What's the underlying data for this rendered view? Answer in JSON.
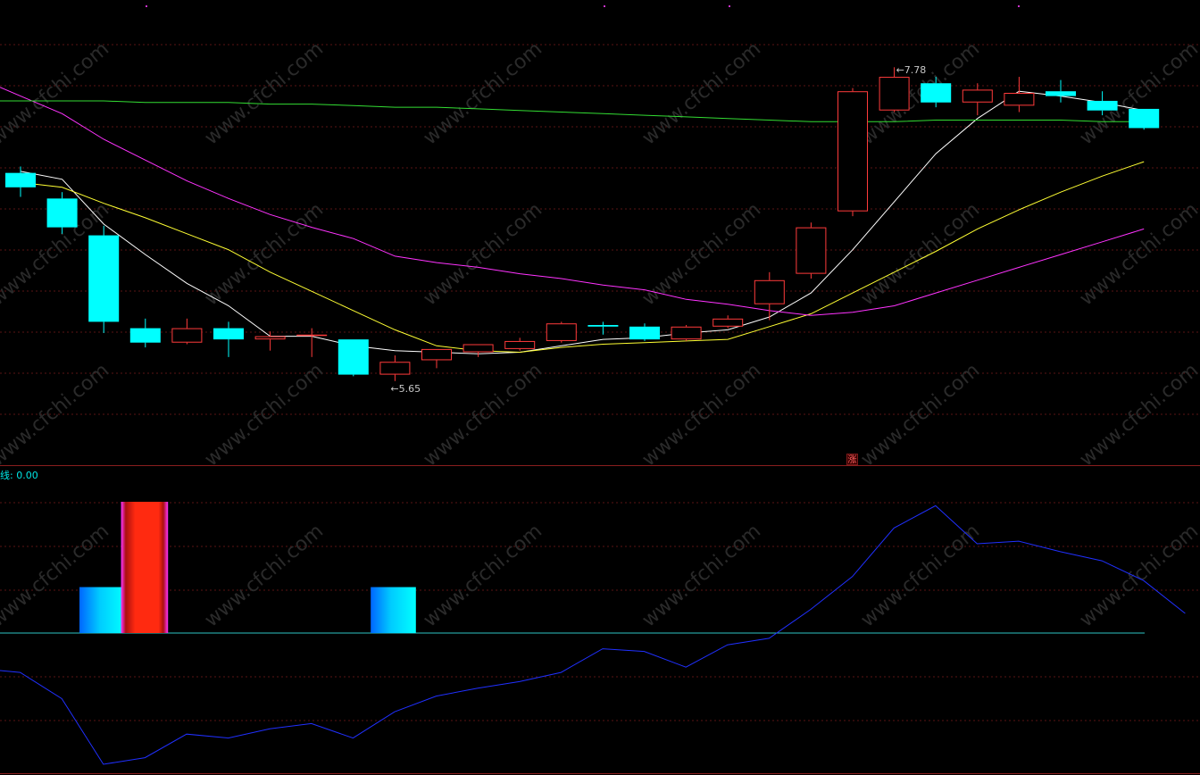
{
  "chart_data": [
    {
      "type": "candlestick",
      "panel": "price",
      "ylim": [
        5.3,
        8.2
      ],
      "grid": true,
      "annotations": [
        {
          "text": "7.78",
          "x_index": 21,
          "value": 7.78
        },
        {
          "text": "5.65",
          "x_index": 9,
          "value": 5.65
        }
      ],
      "badge": "涨",
      "candles": [
        {
          "open": 7.12,
          "high": 7.16,
          "low": 6.97,
          "close": 7.03
        },
        {
          "open": 6.96,
          "high": 7.0,
          "low": 6.74,
          "close": 6.78
        },
        {
          "open": 6.73,
          "high": 6.79,
          "low": 6.12,
          "close": 6.19
        },
        {
          "open": 6.15,
          "high": 6.21,
          "low": 6.03,
          "close": 6.06
        },
        {
          "open": 6.06,
          "high": 6.21,
          "low": 6.05,
          "close": 6.15
        },
        {
          "open": 6.15,
          "high": 6.19,
          "low": 5.97,
          "close": 6.08
        },
        {
          "open": 6.08,
          "high": 6.13,
          "low": 6.01,
          "close": 6.1
        },
        {
          "open": 6.11,
          "high": 6.15,
          "low": 5.97,
          "close": 6.11
        },
        {
          "open": 6.08,
          "high": 6.08,
          "low": 5.85,
          "close": 5.86
        },
        {
          "open": 5.86,
          "high": 5.98,
          "low": 5.82,
          "close": 5.94
        },
        {
          "open": 5.95,
          "high": 6.02,
          "low": 5.9,
          "close": 6.02
        },
        {
          "open": 6.0,
          "high": 6.05,
          "low": 5.97,
          "close": 6.05
        },
        {
          "open": 6.02,
          "high": 6.09,
          "low": 6.01,
          "close": 6.07
        },
        {
          "open": 6.07,
          "high": 6.19,
          "low": 6.06,
          "close": 6.18
        },
        {
          "open": 6.17,
          "high": 6.19,
          "low": 6.11,
          "close": 6.16
        },
        {
          "open": 6.16,
          "high": 6.18,
          "low": 6.07,
          "close": 6.08
        },
        {
          "open": 6.08,
          "high": 6.17,
          "low": 6.07,
          "close": 6.16
        },
        {
          "open": 6.16,
          "high": 6.23,
          "low": 6.15,
          "close": 6.21
        },
        {
          "open": 6.3,
          "high": 6.5,
          "low": 6.2,
          "close": 6.45
        },
        {
          "open": 6.49,
          "high": 6.81,
          "low": 6.46,
          "close": 6.78
        },
        {
          "open": 6.88,
          "high": 7.65,
          "low": 6.85,
          "close": 7.63
        },
        {
          "open": 7.51,
          "high": 7.78,
          "low": 7.5,
          "close": 7.72
        },
        {
          "open": 7.68,
          "high": 7.72,
          "low": 7.53,
          "close": 7.56
        },
        {
          "open": 7.56,
          "high": 7.68,
          "low": 7.48,
          "close": 7.64
        },
        {
          "open": 7.54,
          "high": 7.72,
          "low": 7.5,
          "close": 7.62
        },
        {
          "open": 7.63,
          "high": 7.7,
          "low": 7.56,
          "close": 7.6
        },
        {
          "open": 7.57,
          "high": 7.63,
          "low": 7.48,
          "close": 7.51
        },
        {
          "open": 7.52,
          "high": 7.52,
          "low": 7.39,
          "close": 7.4
        }
      ],
      "series": [
        {
          "color": "#ffffff",
          "values": [
            7.13,
            7.08,
            6.8,
            6.61,
            6.43,
            6.29,
            6.1,
            6.1,
            6.04,
            6.01,
            6.0,
            5.99,
            6.0,
            6.04,
            6.08,
            6.09,
            6.12,
            6.14,
            6.22,
            6.37,
            6.64,
            6.94,
            7.24,
            7.46,
            7.63,
            7.6,
            7.56,
            7.51
          ]
        },
        {
          "color": "#ffff33",
          "values": [
            7.06,
            7.03,
            6.93,
            6.84,
            6.74,
            6.64,
            6.5,
            6.38,
            6.26,
            6.14,
            6.04,
            6.01,
            6.0,
            6.03,
            6.05,
            6.06,
            6.07,
            6.08,
            6.16,
            6.24,
            6.37,
            6.5,
            6.63,
            6.77,
            6.89,
            7.0,
            7.1,
            7.19
          ]
        },
        {
          "color": "#ff33ff",
          "values": [
            7.6,
            7.49,
            7.33,
            7.2,
            7.07,
            6.96,
            6.86,
            6.78,
            6.71,
            6.6,
            6.56,
            6.53,
            6.49,
            6.46,
            6.42,
            6.39,
            6.33,
            6.3,
            6.26,
            6.23,
            6.25,
            6.29,
            6.37,
            6.45,
            6.53,
            6.61,
            6.69,
            6.77
          ]
        },
        {
          "color": "#33dd33",
          "values": [
            7.57,
            7.57,
            7.57,
            7.56,
            7.56,
            7.56,
            7.55,
            7.55,
            7.54,
            7.53,
            7.53,
            7.52,
            7.51,
            7.5,
            7.49,
            7.48,
            7.47,
            7.46,
            7.45,
            7.44,
            7.44,
            7.44,
            7.45,
            7.45,
            7.45,
            7.45,
            7.44,
            7.44
          ]
        }
      ]
    },
    {
      "type": "bar+line",
      "panel": "indicator",
      "label": "线: 0.00",
      "ylim": [
        -100,
        100
      ],
      "zero_line": 0,
      "bars": [
        {
          "start_index": 1,
          "end_index": 2,
          "value": 35,
          "color": "cyan"
        },
        {
          "start_index": 2,
          "end_index": 3,
          "value": 100,
          "color": "red"
        },
        {
          "start_index": 8,
          "end_index": 9,
          "value": 35,
          "color": "cyan"
        }
      ],
      "line": {
        "color": "#2030ff",
        "values": [
          -27,
          -30,
          -50,
          -100,
          -95,
          -77,
          -80,
          -73,
          -69,
          -80,
          -60,
          -48,
          -42,
          -37,
          -30,
          -12,
          -14,
          -26,
          -9,
          -4,
          18,
          43,
          80,
          97,
          68,
          70,
          62,
          55,
          40,
          15
        ]
      }
    }
  ],
  "watermark": "www.cfchi.com"
}
